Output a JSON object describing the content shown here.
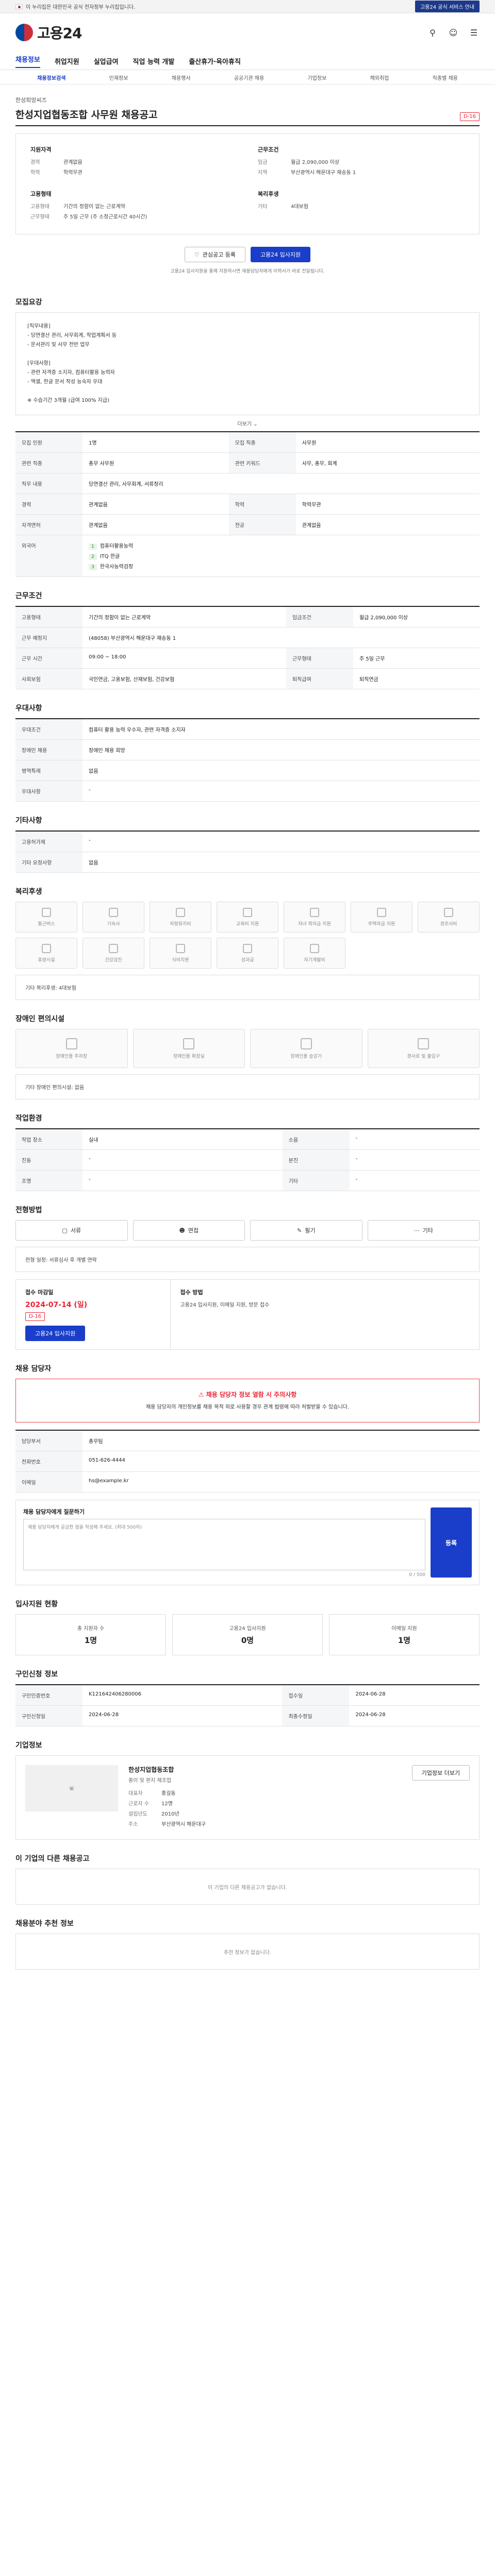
{
  "gov_banner": {
    "text": "이 누리집은 대한민국 공식 전자정부 누리집입니다.",
    "notice": "고용24 공식 서비스 안내"
  },
  "header": {
    "logo": "고용24",
    "icons": [
      "search-icon",
      "user-icon",
      "menu-icon"
    ]
  },
  "gnb": [
    "채용정보",
    "취업지원",
    "실업급여",
    "직업 능력 개발",
    "출산휴가·육아휴직"
  ],
  "subnav": [
    "채용정보검색",
    "인재정보",
    "채용행사",
    "공공기관 채용",
    "기업정보",
    "해외취업",
    "직종별 채용"
  ],
  "job": {
    "company": "한성희망씨즈",
    "title": "한성지업협동조합 사무원 채용공고",
    "dday": "D-16"
  },
  "summary": {
    "groups": [
      {
        "title": "지원자격",
        "rows": [
          [
            "경력",
            "관계없음"
          ],
          [
            "학력",
            "학력무관"
          ]
        ]
      },
      {
        "title": "근무조건",
        "rows": [
          [
            "임금",
            "월급 2,090,000 이상"
          ],
          [
            "지역",
            "부산광역시 해운대구 재송동 1"
          ]
        ]
      },
      {
        "title": "고용형태",
        "rows": [
          [
            "고용형태",
            "기간의 정함이 없는 근로계약"
          ],
          [
            "근무형태",
            "주 5일 근무 (주 소정근로시간 40시간)"
          ]
        ]
      },
      {
        "title": "복리후생",
        "rows": [
          [
            "기타",
            "4대보험"
          ]
        ]
      }
    ]
  },
  "actions": {
    "scrap": "관심공고 등록",
    "apply": "고용24 입사지원",
    "note": "고용24 입사지원을 통해 지원하시면 채용담당자에게 이력서가 바로 전달됩니다."
  },
  "sections": {
    "recruit": "모집요강",
    "recruit_desc": "[직무내용]\n- 당연결산 관리, 사무회계, 작업계획서 등\n- 문서관리 및 사무 전반 업무\n\n[우대사항]\n- 관련 자격증 소지자, 컴퓨터활용 능력자\n- 엑셀, 한글 문서 작성 능숙자 우대\n\n※ 수습기간 3개월 (급여 100% 지급)",
    "more": "더보기",
    "conditions": "근무조건",
    "prefer": "우대사항",
    "extra": "기타사항",
    "welfare": "복리후생",
    "disabled": "장애인 편의시설",
    "worksite": "작업환경",
    "method": "전형방법",
    "contact": "채용 담당자",
    "stats": "입사지원 현황",
    "posting": "구인신청 정보",
    "company": "기업정보",
    "other_jobs": "이 기업의 다른 채용공고",
    "related": "채용분야 추천 정보"
  },
  "recruit_table": [
    [
      "모집 인원",
      "1명",
      "모집 직종",
      "사무원"
    ],
    [
      "관련 직종",
      "총무 사무원",
      "관련 키워드",
      "사무, 총무, 회계"
    ],
    [
      "직무 내용",
      "당연결산 관리, 사무회계, 서류정리",
      "",
      ""
    ],
    [
      "경력",
      "관계없음",
      "학력",
      "학력무관"
    ],
    [
      "자격면허",
      "관계없음",
      "전공",
      "관계없음"
    ]
  ],
  "recruit_lang": {
    "label": "외국어",
    "items": [
      "컴퓨터활용능력",
      "ITQ 한글",
      "한국사능력검정"
    ]
  },
  "conditions_table": [
    [
      "고용형태",
      "기간의 정함이 없는 근로계약",
      "임금조건",
      "월급 2,090,000 이상"
    ],
    [
      "근무 예정지",
      "(48058) 부산광역시 해운대구 재송동 1",
      "",
      ""
    ],
    [
      "근무 시간",
      "09:00 ~ 18:00",
      "근무형태",
      "주 5일 근무"
    ],
    [
      "사회보험",
      "국민연금, 고용보험, 산재보험, 건강보험",
      "퇴직급여",
      "퇴직연금"
    ]
  ],
  "prefer_table": [
    [
      "우대조건",
      "컴퓨터 활용 능력 우수자, 관련 자격증 소지자"
    ],
    [
      "장애인 채용",
      "장애인 채용 희망"
    ],
    [
      "병역특례",
      "없음"
    ],
    [
      "우대사항",
      "-"
    ]
  ],
  "extra_table": [
    [
      "고용허가제",
      "-"
    ],
    [
      "기타 요청사항",
      "없음"
    ]
  ],
  "welfare_items": [
    "통근버스",
    "기숙사",
    "차량유지비",
    "교육비 지원",
    "자녀 학자금 지원",
    "주택자금 지원",
    "경조사비",
    "휴양시설",
    "건강검진",
    "식비지원",
    "성과급",
    "자기계발비"
  ],
  "welfare_note": "기타 복리후생: 4대보험",
  "disabled_items": [
    "장애인용 주차장",
    "장애인용 화장실",
    "장애인용 승강기",
    "경사로 및 출입구"
  ],
  "disabled_note": "기타 장애인 편의시설: 없음",
  "worksite_table": [
    [
      "작업 장소",
      "실내",
      "소음",
      "-"
    ],
    [
      "진동",
      "-",
      "분진",
      "-"
    ],
    [
      "조명",
      "-",
      "기타",
      "-"
    ]
  ],
  "methods": [
    "서류",
    "면접",
    "필기",
    "기타"
  ],
  "method_note": "전형 일정: 서류심사 후 개별 연락",
  "apply": {
    "label": "접수 마감일",
    "deadline": "2024-07-14 (일)",
    "remain": "D-16",
    "how_label": "접수 방법",
    "how": "고용24 입사지원, 이메일 지원, 방문 접수"
  },
  "contact_notice": {
    "title": "채용 담당자 정보 열람 시 주의사항",
    "body": "채용 담당자의 개인정보를 채용 목적 외로 사용할 경우 관계 법령에 따라 처벌받을 수 있습니다."
  },
  "contact_rows": [
    [
      "담당부서",
      "총무팀"
    ],
    [
      "전화번호",
      "051-626-4444"
    ],
    [
      "이메일",
      "hs@example.kr"
    ]
  ],
  "qa": {
    "title": "채용 담당자에게 질문하기",
    "placeholder": "채용 담당자에게 궁금한 점을 작성해 주세요. (최대 500자)",
    "count": "0 / 500",
    "submit": "등록"
  },
  "stats": [
    [
      "총 지원자 수",
      "1명"
    ],
    [
      "고용24 입사지원",
      "0명"
    ],
    [
      "이메일 지원",
      "1명"
    ]
  ],
  "posting_table": [
    [
      "구인인증번호",
      "K121642406280006",
      "접수일",
      "2024-06-28"
    ],
    [
      "구인신청일",
      "2024-06-28",
      "최종수정일",
      "2024-06-28"
    ]
  ],
  "company_info": {
    "name": "한성지업협동조합",
    "industry": "종이 및 판지 제조업",
    "rows": [
      [
        "대표자",
        "홍길동"
      ],
      [
        "근로자 수",
        "12명"
      ],
      [
        "설립년도",
        "2010년"
      ],
      [
        "주소",
        "부산광역시 해운대구"
      ]
    ],
    "button": "기업정보 더보기"
  },
  "other_jobs_empty": "이 기업의 다른 채용공고가 없습니다.",
  "related_empty": "추천 정보가 없습니다."
}
